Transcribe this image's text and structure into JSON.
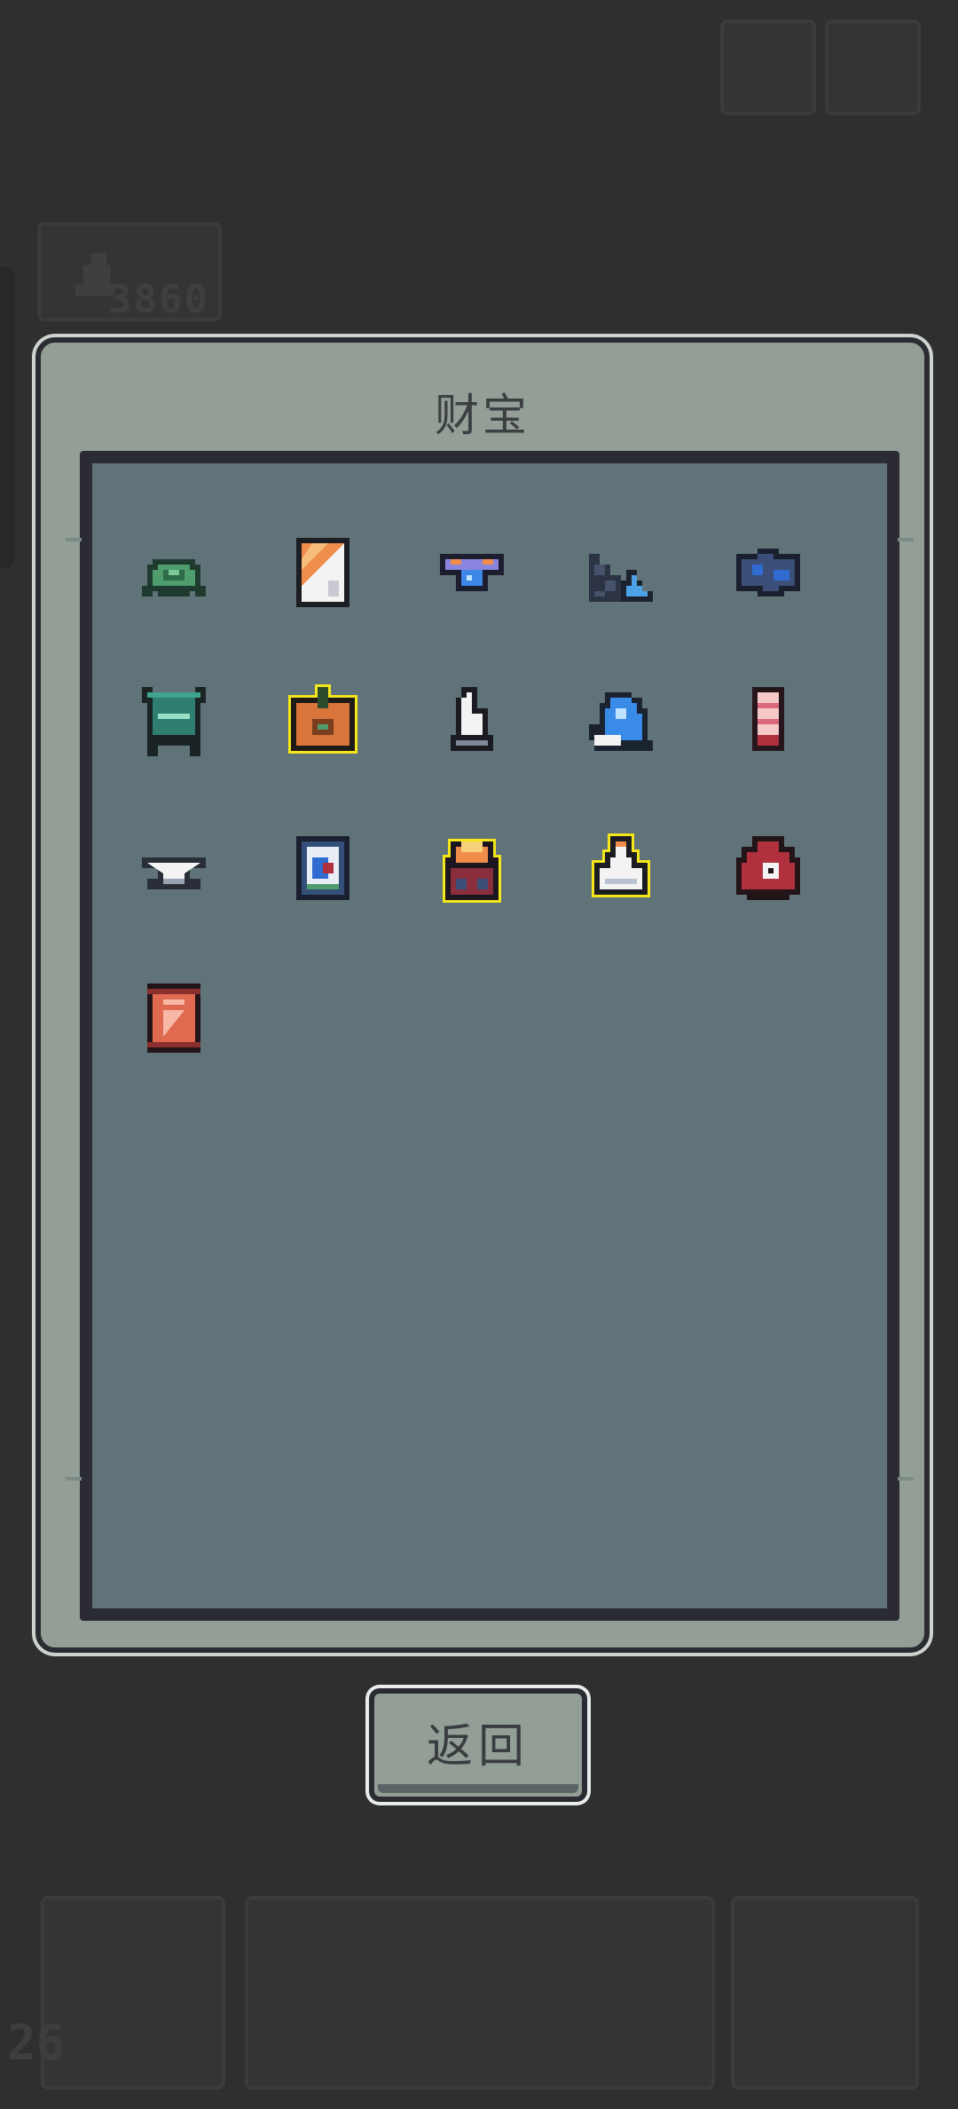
{
  "header": {
    "gold_amount": "3860"
  },
  "bottom_bar": {
    "level": "26"
  },
  "treasure_dialog": {
    "title": "财宝",
    "back_label": "返回"
  },
  "treasures": [
    {
      "icon": "green-turtle-shell-icon",
      "highlighted": false
    },
    {
      "icon": "orange-scroll-icon",
      "highlighted": false
    },
    {
      "icon": "blue-gem-amulet-icon",
      "highlighted": false
    },
    {
      "icon": "wave-brick-icon",
      "highlighted": false
    },
    {
      "icon": "dark-blue-ore-icon",
      "highlighted": false
    },
    {
      "icon": "teal-altar-icon",
      "highlighted": false
    },
    {
      "icon": "pumpkin-crate-icon",
      "highlighted": true
    },
    {
      "icon": "white-pawn-icon",
      "highlighted": false
    },
    {
      "icon": "blue-snail-shell-icon",
      "highlighted": false
    },
    {
      "icon": "pink-potion-vial-icon",
      "highlighted": false
    },
    {
      "icon": "silver-anvil-icon",
      "highlighted": false
    },
    {
      "icon": "framed-portrait-icon",
      "highlighted": false
    },
    {
      "icon": "fire-brazier-icon",
      "highlighted": true
    },
    {
      "icon": "white-vase-icon",
      "highlighted": true
    },
    {
      "icon": "red-money-bag-icon",
      "highlighted": false
    },
    {
      "icon": "red-banner-icon",
      "highlighted": false
    }
  ],
  "colors": {
    "background": "#2f2f30",
    "dialog_frame": "#939e97",
    "inner_panel": "#5f7378",
    "highlight": "#f4e61a"
  }
}
